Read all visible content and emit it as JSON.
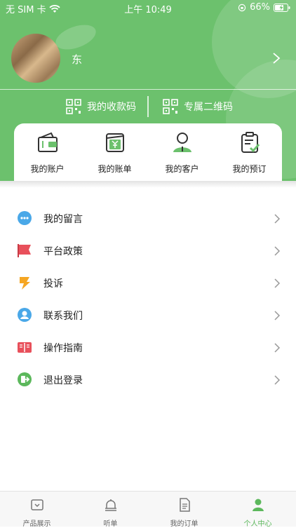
{
  "status_bar": {
    "carrier": "无 SIM 卡",
    "time": "上午 10:49",
    "battery": "66%"
  },
  "profile": {
    "name": "东"
  },
  "quick_links": {
    "collect_code": "我的收款码",
    "exclusive_qr": "专属二维码"
  },
  "account_card": {
    "items": [
      {
        "label": "我的账户",
        "icon": "wallet-icon"
      },
      {
        "label": "我的账单",
        "icon": "bill-icon"
      },
      {
        "label": "我的客户",
        "icon": "customer-icon"
      },
      {
        "label": "我的预订",
        "icon": "booking-icon"
      }
    ]
  },
  "menu": {
    "items": [
      {
        "label": "我的留言",
        "icon": "message-icon"
      },
      {
        "label": "平台政策",
        "icon": "flag-icon"
      },
      {
        "label": "投诉",
        "icon": "complaint-icon"
      },
      {
        "label": "联系我们",
        "icon": "contact-icon"
      },
      {
        "label": "操作指南",
        "icon": "guide-book-icon"
      },
      {
        "label": "退出登录",
        "icon": "logout-icon"
      }
    ]
  },
  "tabbar": {
    "tabs": [
      {
        "label": "产品展示",
        "icon": "product-icon"
      },
      {
        "label": "听单",
        "icon": "bell-icon"
      },
      {
        "label": "我的订单",
        "icon": "order-icon"
      },
      {
        "label": "个人中心",
        "icon": "person-icon",
        "active": true
      }
    ]
  },
  "colors": {
    "brand_green": "#6cc16d",
    "active_tab": "#5cb85c"
  }
}
